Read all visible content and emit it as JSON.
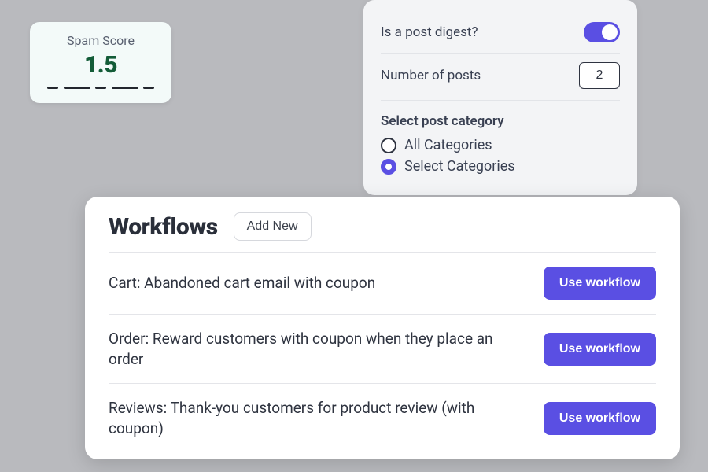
{
  "spam": {
    "title": "Spam Score",
    "value": "1.5"
  },
  "settings": {
    "digest_label": "Is a post digest?",
    "digest_on": true,
    "num_posts_label": "Number of posts",
    "num_posts_value": "2",
    "category_heading": "Select post category",
    "option_all": "All Categories",
    "option_select": "Select Categories"
  },
  "workflows": {
    "title": "Workflows",
    "add_new_label": "Add New",
    "use_label": "Use workflow",
    "items": [
      {
        "name": "Cart: Abandoned cart email with coupon"
      },
      {
        "name": "Order: Reward customers with coupon when they place an order"
      },
      {
        "name": "Reviews: Thank-you customers for product review (with coupon)"
      }
    ]
  }
}
